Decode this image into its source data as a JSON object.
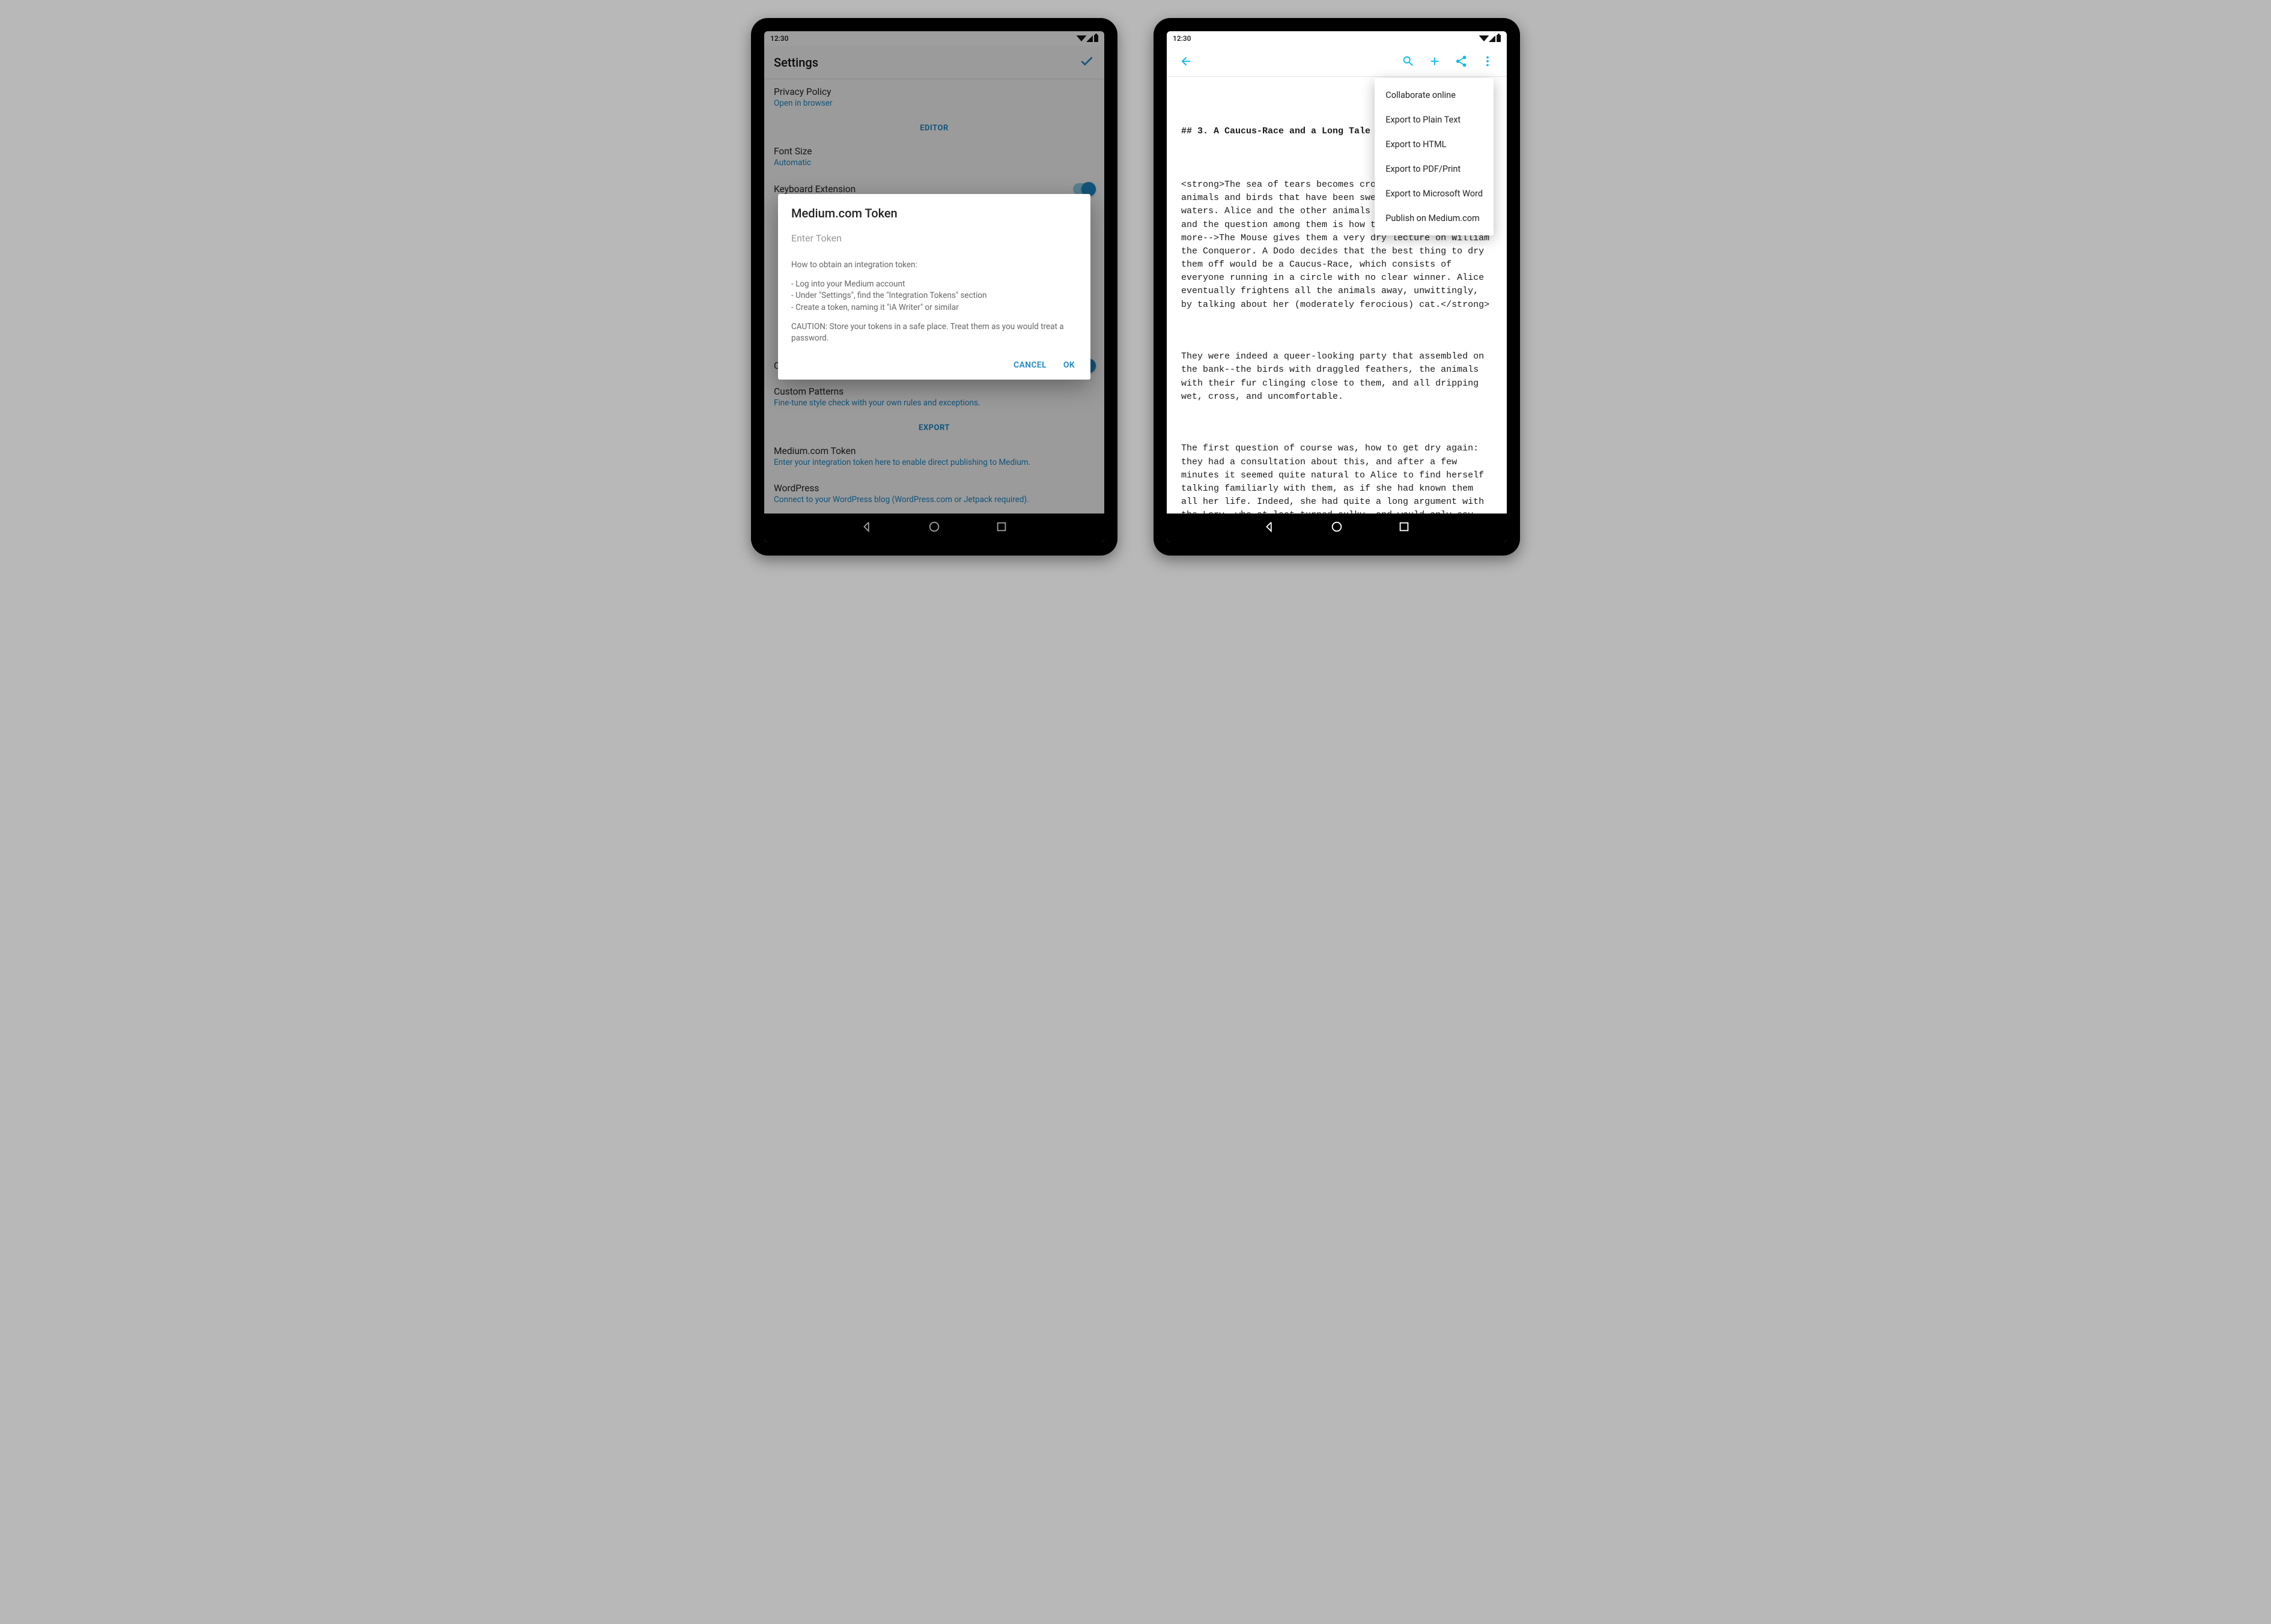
{
  "status": {
    "time": "12:30"
  },
  "left": {
    "appbar": {
      "title": "Settings"
    },
    "prefs": {
      "privacy": {
        "title": "Privacy Policy",
        "sub": "Open in browser"
      },
      "section_editor": "EDITOR",
      "font": {
        "title": "Font Size",
        "sub": "Automatic"
      },
      "kbd": {
        "title": "Keyboard Extension"
      },
      "custom": {
        "title": "Custom"
      },
      "patterns": {
        "title": "Custom Patterns",
        "sub": "Fine-tune style check with your own rules and exceptions."
      },
      "section_export": "EXPORT",
      "medium": {
        "title": "Medium.com Token",
        "sub": "Enter your integration token here to enable direct publishing to Medium."
      },
      "wp": {
        "title": "WordPress",
        "sub": "Connect to your WordPress blog (WordPress.com or Jetpack required)."
      }
    },
    "dialog": {
      "title": "Medium.com Token",
      "placeholder": "Enter Token",
      "howto_title": "How to obtain an integration token:",
      "step1": "- Log into your Medium account",
      "step2": "- Under \"Settings\", find the \"Integration Tokens\" section",
      "step3": "- Create a token, naming it \"iA Writer\" or similar",
      "caution": "CAUTION: Store your tokens in a safe place. Treat them as you would treat a password.",
      "cancel": "CANCEL",
      "ok": "OK"
    }
  },
  "right": {
    "menu": {
      "items": [
        "Collaborate online",
        "Export to Plain Text",
        "Export to HTML",
        "Export to PDF/Print",
        "Export to Microsoft Word",
        "Publish on Medium.com"
      ]
    },
    "doc": {
      "heading": "## 3. A Caucus-Race and a Long Tale",
      "p1": "<strong>The sea of tears becomes crowded with other animals and birds that have been swept away by the rising waters. Alice and the other animals convene on the bank and the question among them is how to get dry again. <!--more-->The Mouse gives them a very dry lecture on William the Conqueror. A Dodo decides that the best thing to dry them off would be a Caucus-Race, which consists of everyone running in a circle with no clear winner. Alice eventually frightens all the animals away, unwittingly, by talking about her (moderately ferocious) cat.</strong>",
      "p2": "They were indeed a queer-looking party that assembled on the bank--the birds with draggled feathers, the animals with their fur clinging close to them, and all dripping wet, cross, and uncomfortable.",
      "p3": "The first question of course was, how to get dry again: they had a consultation about this, and after a few minutes it seemed quite natural to Alice to find herself talking familiarly with them, as if she had known them all her life. Indeed, she had quite a long argument with the Lory, who at last turned sulky, and would only say, \"I am older than you, and"
    }
  }
}
